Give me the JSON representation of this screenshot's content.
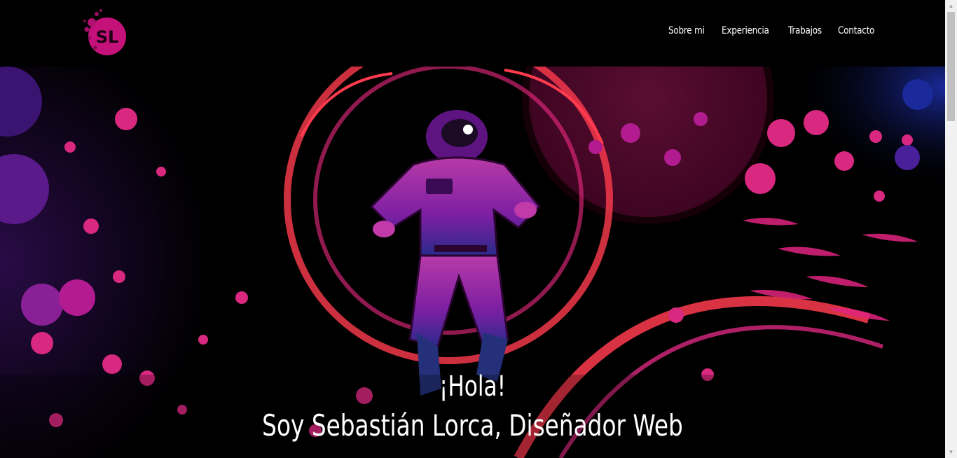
{
  "logo": {
    "text": "SL",
    "color": "#c4127a"
  },
  "nav": {
    "items": [
      {
        "label": "Sobre mi"
      },
      {
        "label": "Experiencia"
      },
      {
        "label": "Trabajos"
      },
      {
        "label": "Contacto"
      }
    ]
  },
  "hero": {
    "greeting": "¡Hola!",
    "subtitle": "Soy Sebastián Lorca, Diseñador Web",
    "colors": {
      "magenta": "#d8287f",
      "pink": "#f02a84",
      "red": "#ff3b4d",
      "purple": "#7b1fa2",
      "blue": "#1a2a9a"
    }
  }
}
